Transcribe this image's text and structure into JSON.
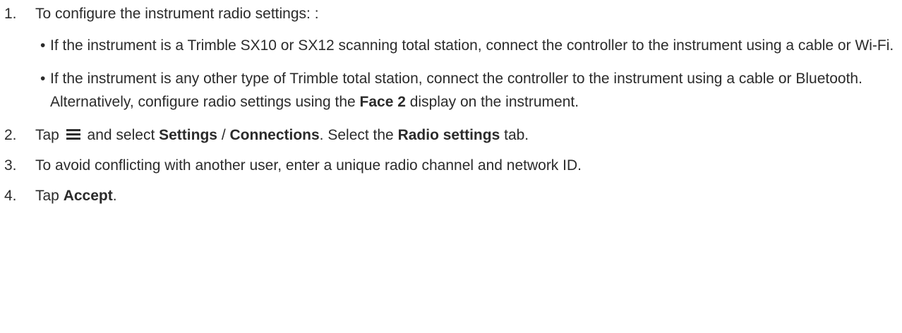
{
  "steps": [
    {
      "num": "1.",
      "text": "To configure the instrument radio settings: :",
      "bullets": [
        {
          "text": "If the instrument is a Trimble SX10 or SX12 scanning total station, connect the controller to the instrument using a cable or Wi-Fi."
        },
        {
          "text_a": "If the instrument is any other type of Trimble total station, connect the controller to the instrument using a cable or Bluetooth. Alternatively, configure radio settings using the ",
          "bold": "Face 2",
          "text_b": " display on the instrument."
        }
      ]
    },
    {
      "num": "2.",
      "tap": "Tap",
      "icon": "menu-icon",
      "and_select": "and select",
      "settings": "Settings",
      "slash": "/",
      "connections": "Connections",
      "select_the": ". Select the",
      "radio_settings": "Radio settings",
      "tab": "tab."
    },
    {
      "num": "3.",
      "text": "To avoid conflicting with another user, enter a unique radio channel and network ID."
    },
    {
      "num": "4.",
      "tap": "Tap",
      "accept": "Accept",
      "period": "."
    }
  ]
}
